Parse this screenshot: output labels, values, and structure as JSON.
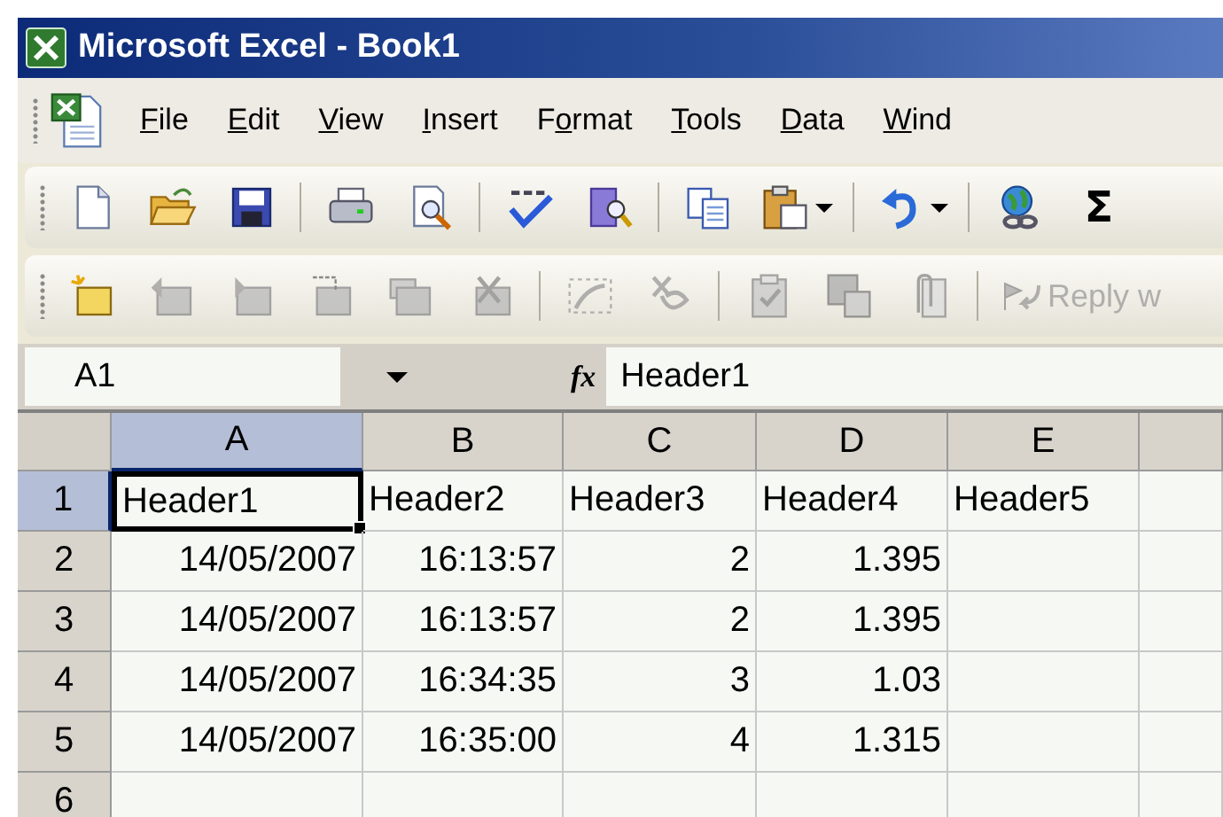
{
  "window": {
    "title": "Microsoft Excel - Book1"
  },
  "menu": [
    {
      "key": "F",
      "rest": "ile"
    },
    {
      "key": "E",
      "rest": "dit"
    },
    {
      "key": "V",
      "rest": "iew"
    },
    {
      "key": "I",
      "rest": "nsert"
    },
    {
      "lead": "F",
      "key": "o",
      "rest": "rmat"
    },
    {
      "key": "T",
      "rest": "ools"
    },
    {
      "key": "D",
      "rest": "ata"
    },
    {
      "key": "W",
      "rest": "ind"
    }
  ],
  "standard_toolbar": [
    {
      "kind": "new",
      "dropdown": false
    },
    {
      "kind": "open",
      "dropdown": false
    },
    {
      "kind": "save",
      "dropdown": false
    },
    {
      "kind": "separator"
    },
    {
      "kind": "print",
      "dropdown": false
    },
    {
      "kind": "preview",
      "dropdown": false
    },
    {
      "kind": "separator"
    },
    {
      "kind": "spelling",
      "dropdown": false
    },
    {
      "kind": "research",
      "dropdown": false
    },
    {
      "kind": "separator"
    },
    {
      "kind": "copy",
      "dropdown": false
    },
    {
      "kind": "paste",
      "dropdown": true
    },
    {
      "kind": "separator"
    },
    {
      "kind": "undo",
      "dropdown": true
    },
    {
      "kind": "separator"
    },
    {
      "kind": "hyperlink",
      "dropdown": false
    },
    {
      "kind": "text",
      "label": "Σ",
      "dropdown": false
    }
  ],
  "reviewing_toolbar": [
    {
      "kind": "note-new",
      "disabled": false
    },
    {
      "kind": "note-back",
      "disabled": true
    },
    {
      "kind": "note-forward",
      "disabled": true
    },
    {
      "kind": "note-edit",
      "disabled": true
    },
    {
      "kind": "notes",
      "disabled": true
    },
    {
      "kind": "note-delete",
      "disabled": true
    },
    {
      "kind": "separator"
    },
    {
      "kind": "ink",
      "disabled": true
    },
    {
      "kind": "ink-delete",
      "disabled": true
    },
    {
      "kind": "separator"
    },
    {
      "kind": "clipboard",
      "disabled": true
    },
    {
      "kind": "save",
      "disabled": true
    },
    {
      "kind": "attach",
      "disabled": true
    },
    {
      "kind": "separator"
    },
    {
      "kind": "reply",
      "label": "Reply w",
      "disabled": true
    }
  ],
  "formula_bar": {
    "name_box": "A1",
    "function_label": "fx",
    "value": "Header1"
  },
  "grid": {
    "columns": [
      {
        "label": "A",
        "selected": true
      },
      {
        "label": "B",
        "selected": false
      },
      {
        "label": "C",
        "selected": false
      },
      {
        "label": "D",
        "selected": false
      },
      {
        "label": "E",
        "selected": false
      }
    ],
    "rows": [
      {
        "header": "1",
        "selected": true,
        "cells": [
          {
            "value": "Header1",
            "kind": "text",
            "active": true
          },
          {
            "value": "Header2",
            "kind": "text",
            "active": false
          },
          {
            "value": "Header3",
            "kind": "text",
            "active": false
          },
          {
            "value": "Header4",
            "kind": "text",
            "active": false
          },
          {
            "value": "Header5",
            "kind": "text",
            "active": false
          }
        ]
      },
      {
        "header": "2",
        "selected": false,
        "cells": [
          {
            "value": "14/05/2007",
            "kind": "number",
            "active": false
          },
          {
            "value": "16:13:57",
            "kind": "number",
            "active": false
          },
          {
            "value": "2",
            "kind": "number",
            "active": false
          },
          {
            "value": "1.395",
            "kind": "number",
            "active": false
          }
        ]
      },
      {
        "header": "3",
        "selected": false,
        "cells": [
          {
            "value": "14/05/2007",
            "kind": "number",
            "active": false
          },
          {
            "value": "16:13:57",
            "kind": "number",
            "active": false
          },
          {
            "value": "2",
            "kind": "number",
            "active": false
          },
          {
            "value": "1.395",
            "kind": "number",
            "active": false
          }
        ]
      },
      {
        "header": "4",
        "selected": false,
        "cells": [
          {
            "value": "14/05/2007",
            "kind": "number",
            "active": false
          },
          {
            "value": "16:34:35",
            "kind": "number",
            "active": false
          },
          {
            "value": "3",
            "kind": "number",
            "active": false
          },
          {
            "value": "1.03",
            "kind": "number",
            "active": false
          }
        ]
      },
      {
        "header": "5",
        "selected": false,
        "cells": [
          {
            "value": "14/05/2007",
            "kind": "number",
            "active": false
          },
          {
            "value": "16:35:00",
            "kind": "number",
            "active": false
          },
          {
            "value": "4",
            "kind": "number",
            "active": false
          },
          {
            "value": "1.315",
            "kind": "number",
            "active": false
          }
        ]
      },
      {
        "header": "6",
        "selected": false,
        "cells": []
      }
    ]
  }
}
